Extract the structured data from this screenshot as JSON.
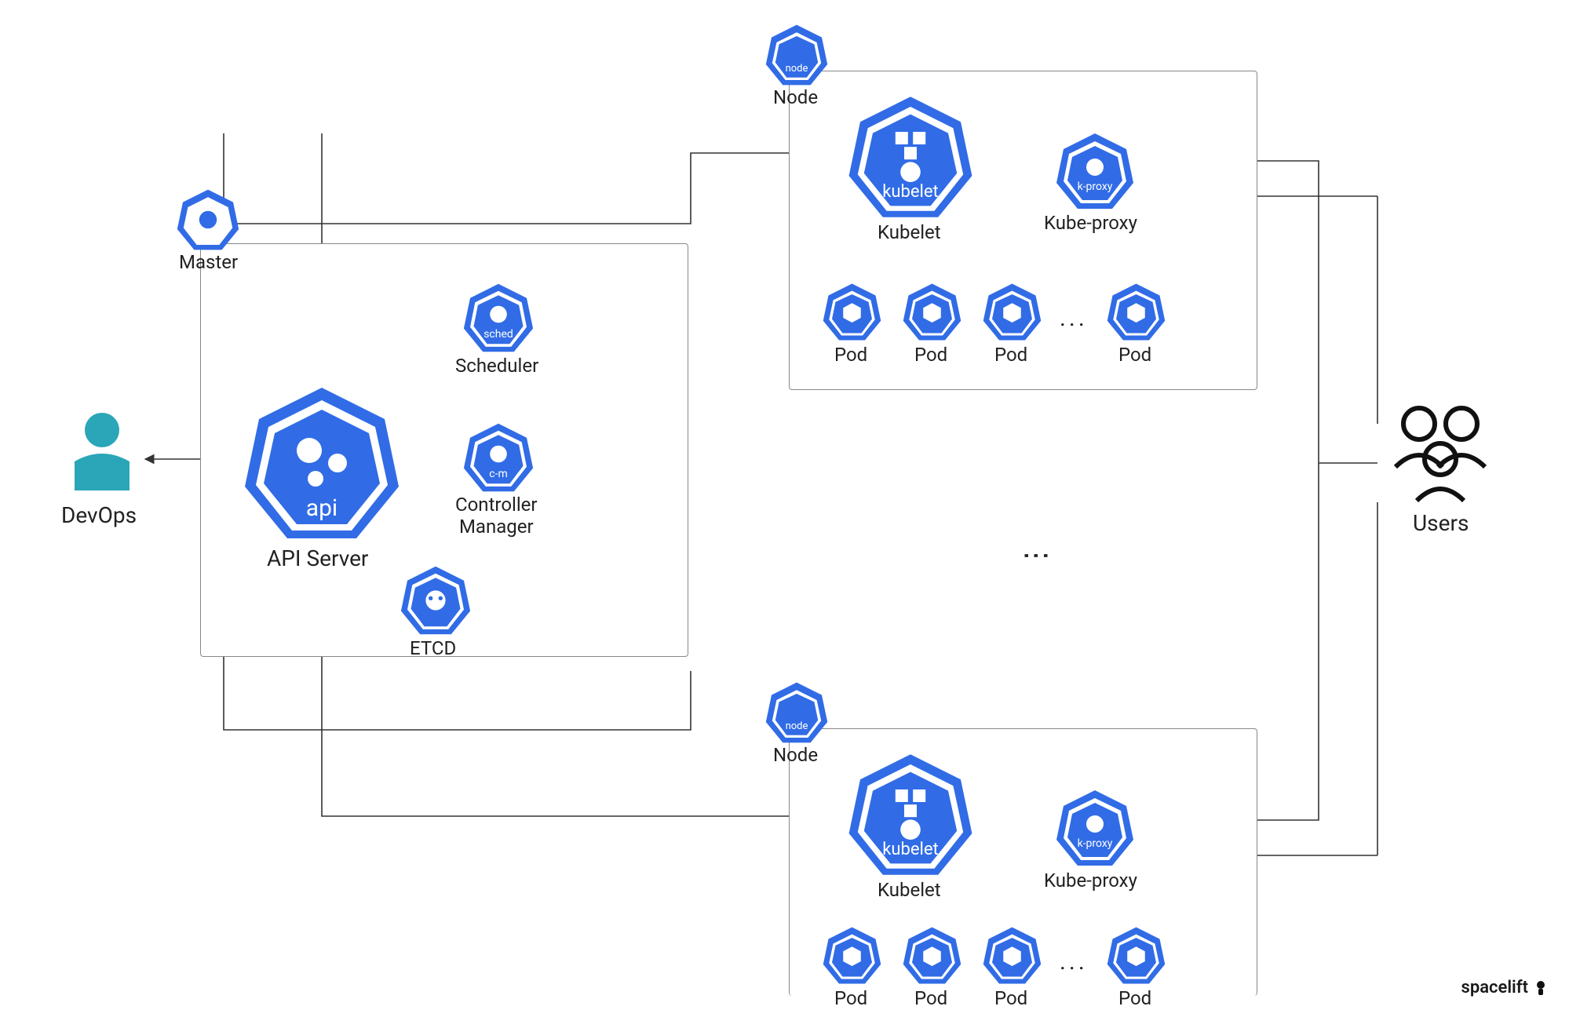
{
  "actors": {
    "devops": "DevOps",
    "users": "Users"
  },
  "master": {
    "badge": "Master",
    "api_server": {
      "inner": "api",
      "label": "API Server"
    },
    "scheduler": {
      "inner": "sched",
      "label": "Scheduler"
    },
    "controller_manager": {
      "inner": "c-m",
      "label": "Controller\nManager"
    },
    "etcd": {
      "inner": "",
      "label": "ETCD"
    }
  },
  "node_template": {
    "badge": {
      "inner": "node",
      "label": "Node"
    },
    "kubelet": {
      "inner": "kubelet",
      "label": "Kubelet"
    },
    "kube_proxy": {
      "inner": "k-proxy",
      "label": "Kube-proxy"
    },
    "pod_label": "Pod"
  },
  "ellipsis": "...",
  "watermark": "spacelift"
}
